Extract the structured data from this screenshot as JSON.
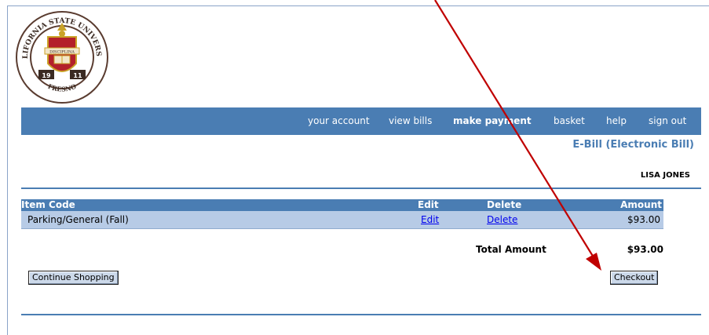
{
  "logo": {
    "text_top": "CALIFORNIA STATE UNIVERSITY",
    "text_bottom": "FRESNO",
    "banner": "DISCIPLINA",
    "year_left": "19",
    "year_right": "11"
  },
  "nav": {
    "items": [
      "your account",
      "view bills",
      "make payment",
      "basket",
      "help",
      "sign out"
    ],
    "active": "make payment"
  },
  "page": {
    "title": "E-Bill (Electronic Bill)",
    "customer_name": "LISA JONES"
  },
  "table": {
    "headers": {
      "item_code": "Item Code",
      "edit": "Edit",
      "delete": "Delete",
      "amount": "Amount"
    },
    "rows": [
      {
        "item_code": "Parking/General (Fall)",
        "edit": "Edit",
        "delete": "Delete",
        "amount": "$93.00"
      }
    ]
  },
  "totals": {
    "label": "Total Amount",
    "value": "$93.00"
  },
  "buttons": {
    "continue_shopping": "Continue Shopping",
    "checkout": "Checkout"
  },
  "colors": {
    "nav_bar": "#4a7db3",
    "row_bg": "#b7cbe6",
    "annotation_arrow": "#c00000",
    "seal_red": "#b3202a",
    "seal_gold": "#c9a227"
  }
}
